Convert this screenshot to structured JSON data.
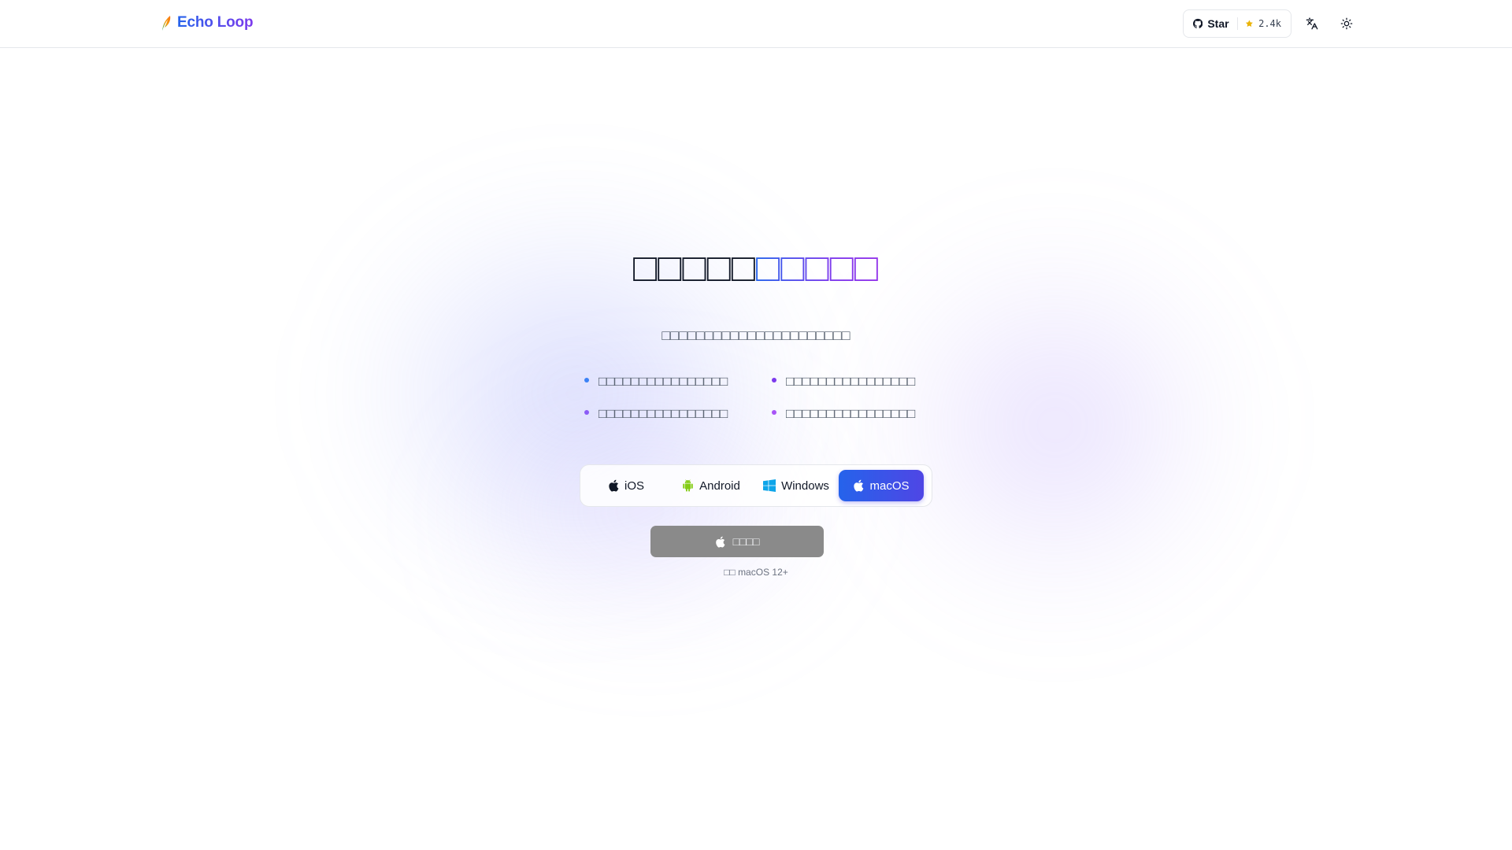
{
  "header": {
    "brand": {
      "name": "Echo Loop",
      "logo_icon": "quill-feather-icon"
    },
    "github": {
      "label": "Star",
      "count": "2.4k",
      "icon": "github-icon",
      "star_icon": "star-icon"
    },
    "translate_icon": "translate-icon",
    "theme_icon": "sun-icon"
  },
  "hero": {
    "title_part1": "□□□□□",
    "title_part2": "□□□□□",
    "subtitle": "□□□□□□□□□□□□□□□□□□□□□□",
    "features": [
      {
        "text": "□□□□□□□□□□□□□□□□",
        "dot_color": "#3b82f6"
      },
      {
        "text": "□□□□□□□□□□□□□□□□",
        "dot_color": "#7c3aed"
      },
      {
        "text": "□□□□□□□□□□□□□□□□",
        "dot_color": "#8b5cf6"
      },
      {
        "text": "□□□□□□□□□□□□□□□□",
        "dot_color": "#a855f7"
      }
    ]
  },
  "platforms": {
    "tabs": [
      {
        "label": "iOS",
        "icon": "apple-icon"
      },
      {
        "label": "Android",
        "icon": "android-icon"
      },
      {
        "label": "Windows",
        "icon": "windows-icon"
      },
      {
        "label": "macOS",
        "icon": "apple-icon"
      }
    ],
    "selected": "macOS"
  },
  "download": {
    "label": "□□□□",
    "icon": "apple-icon",
    "requirement": "□□ macOS 12+"
  },
  "colors": {
    "accent_blue": "#2563eb",
    "accent_purple": "#7c3aed",
    "download_disabled": "#8a8a8a"
  }
}
